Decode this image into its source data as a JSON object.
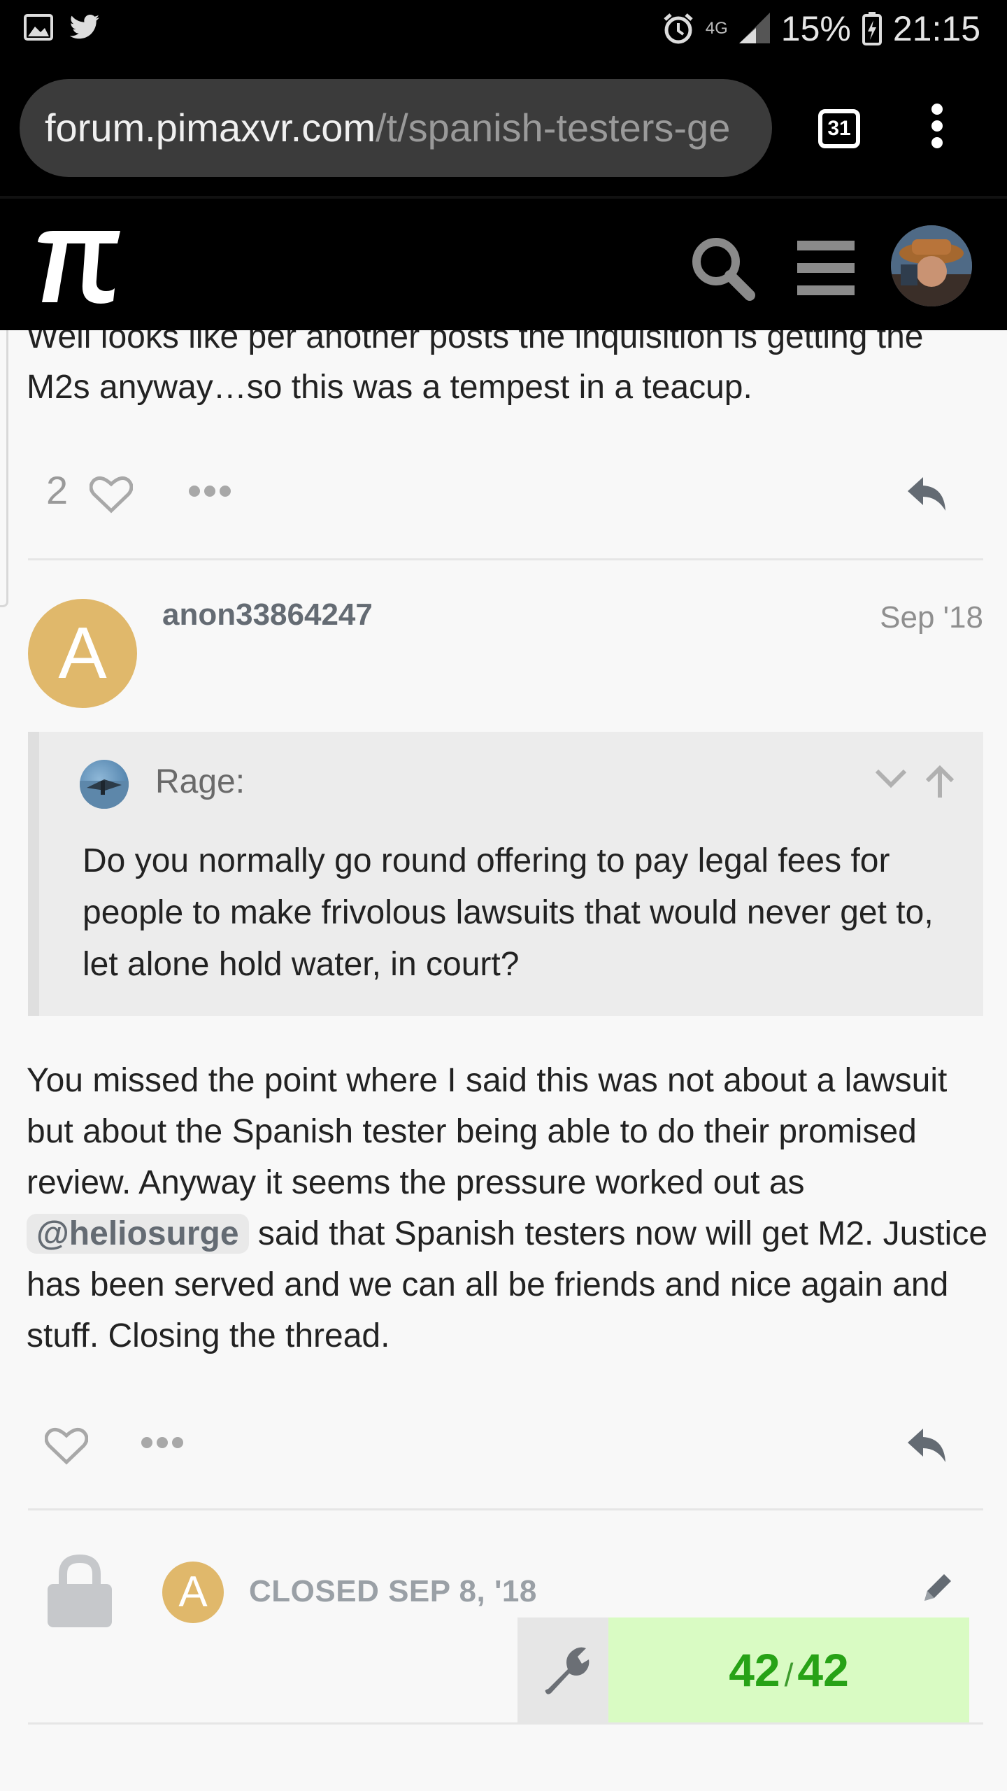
{
  "status_bar": {
    "network": "4G",
    "battery": "15%",
    "time": "21:15"
  },
  "browser": {
    "url_domain": "forum.pimaxvr.com",
    "url_path": "/t/spanish-testers-ge",
    "tab_count": "31"
  },
  "forum": {
    "logo_glyph": "π"
  },
  "previous_post": {
    "text": "Well looks like per another posts the inquisition is getting the M2s anyway…so this was a tempest in a teacup.",
    "like_count": "2"
  },
  "post": {
    "avatar_letter": "A",
    "username": "anon33864247",
    "date": "Sep '18",
    "quote": {
      "author": "Rage:",
      "text": "Do you normally go round offering to pay legal fees for people to make frivolous lawsuits that would never get to, let alone hold water, in court?"
    },
    "body_before": "You missed the point where I said this was not about a lawsuit but about the Spanish tester being able to do their promised review. Anyway it seems the pressure worked out as ",
    "mention": "@heliosurge",
    "body_after": " said that Spanish testers now will get M2. Justice has been served and we can all be friends and nice again and stuff. Closing the thread."
  },
  "closed_notice": {
    "avatar_letter": "A",
    "text": "CLOSED SEP 8, '18"
  },
  "progress": {
    "current": "42",
    "separator": "/",
    "total": "42"
  },
  "colors": {
    "accent_green": "#27a216",
    "progress_bg": "#d9fbc3",
    "avatar_bg": "#e0b86b"
  }
}
